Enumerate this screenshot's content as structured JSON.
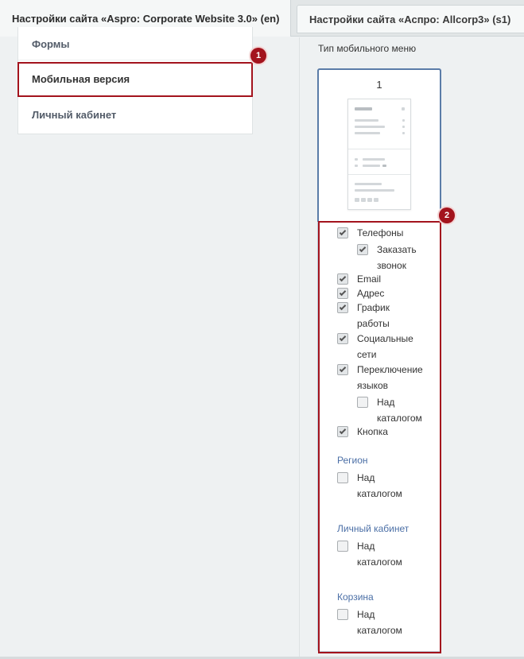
{
  "tabs": [
    {
      "label": "Настройки сайта «Aspro: Corporate Website 3.0» (en)"
    },
    {
      "label": "Настройки сайта «Аспро: Allcorp3» (s1)"
    }
  ],
  "nav": {
    "items": [
      {
        "label": "Формы"
      },
      {
        "label": "Мобильная версия"
      },
      {
        "label": "Личный кабинет"
      }
    ]
  },
  "badges": [
    "1",
    "2"
  ],
  "mobile_menu": {
    "title": "Тип мобильного меню",
    "card_number": "1",
    "options": {
      "phones": {
        "label": "Телефоны",
        "checked": true
      },
      "callback": {
        "label_1": "Заказать",
        "label_2": "звонок",
        "checked": true
      },
      "email": {
        "label": "Email",
        "checked": true
      },
      "address": {
        "label": "Адрес",
        "checked": true
      },
      "schedule": {
        "label_1": "График",
        "label_2": "работы",
        "checked": true
      },
      "social": {
        "label_1": "Социальные",
        "label_2": "сети",
        "checked": true
      },
      "lang": {
        "label_1": "Переключение",
        "label_2": "языков",
        "checked": true
      },
      "lang_above": {
        "label_1": "Над",
        "label_2": "каталогом",
        "checked": false
      },
      "button": {
        "label": "Кнопка",
        "checked": true
      }
    },
    "groups": [
      {
        "title": "Регион",
        "above_1": "Над",
        "above_2": "каталогом",
        "checked": false
      },
      {
        "title": "Личный кабинет",
        "above_1": "Над",
        "above_2": "каталогом",
        "checked": false
      },
      {
        "title": "Корзина",
        "above_1": "Над",
        "above_2": "каталогом",
        "checked": false
      }
    ]
  },
  "colors": {
    "highlight": "#a3131d",
    "link_blue": "#4b6fa6",
    "selected_border": "#5a7ca8"
  }
}
